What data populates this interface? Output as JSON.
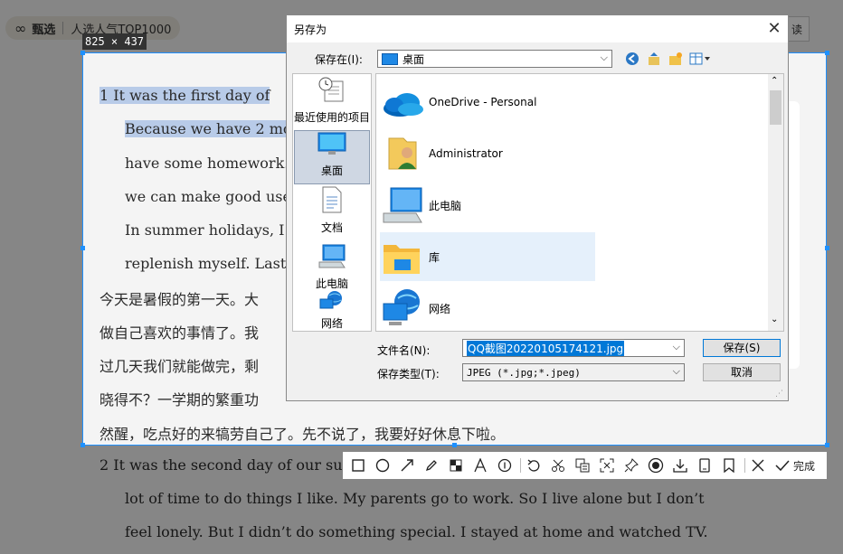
{
  "app": {
    "logo_text": "甄选",
    "tag_text": "人选人气TOP1000",
    "read_btn": "读"
  },
  "selection": {
    "size_label": "825 × 437"
  },
  "document": {
    "lines": [
      {
        "text": "1   It was the first day of",
        "hl": true
      },
      {
        "text": "Because we have 2 mo",
        "hl": true
      },
      {
        "text": "have some homework.",
        "hl": false
      },
      {
        "text": "we can make good use",
        "hl": false
      },
      {
        "text": "In summer holidays, I",
        "hl": false
      },
      {
        "text": "replenish myself. Last b",
        "hl": false
      },
      {
        "text": "今天是暑假的第一天。大",
        "hl": false
      },
      {
        "text": "做自己喜欢的事情了。我",
        "hl": false
      },
      {
        "text": "过几天我们就能做完，剩",
        "hl": false
      },
      {
        "text": "晓得不？一学期的繁重功",
        "hl": false
      },
      {
        "text": "然醒，吃点好的来犒劳自己了。先不说了，我要好好休息下啦。",
        "hl": false
      },
      {
        "text": "2   It was the second day of our su",
        "hl": false
      },
      {
        "text": "lot of time to do things I like. My parents go to work. So I live alone but I don’t",
        "hl": false
      },
      {
        "text": "feel lonely. But I didn’t do something special. I stayed at home and watched TV.",
        "hl": false
      }
    ]
  },
  "dialog": {
    "title": "另存为",
    "save_in_label": "保存在(I):",
    "save_in_value": "桌面",
    "places": [
      {
        "label": "最近使用的项目",
        "icon": "recent-icon"
      },
      {
        "label": "桌面",
        "icon": "desktop-icon"
      },
      {
        "label": "文档",
        "icon": "documents-icon"
      },
      {
        "label": "此电脑",
        "icon": "this-pc-icon"
      },
      {
        "label": "网络",
        "icon": "network-icon"
      }
    ],
    "items": [
      {
        "label": "OneDrive - Personal",
        "icon": "onedrive-icon"
      },
      {
        "label": "Administrator",
        "icon": "user-folder-icon"
      },
      {
        "label": "此电脑",
        "icon": "this-pc-icon"
      },
      {
        "label": "库",
        "icon": "library-icon"
      },
      {
        "label": "网络",
        "icon": "network-icon"
      }
    ],
    "filename_label": "文件名(N):",
    "filename_value": "QQ截图20220105174121.jpg",
    "filetype_label": "保存类型(T):",
    "filetype_value": "JPEG (*.jpg;*.jpeg)",
    "save_btn": "保存(S)",
    "cancel_btn": "取消"
  },
  "toolbar": {
    "done_label": "完成"
  },
  "colors": {
    "selection": "#1e90ff",
    "accent": "#0078d7"
  }
}
